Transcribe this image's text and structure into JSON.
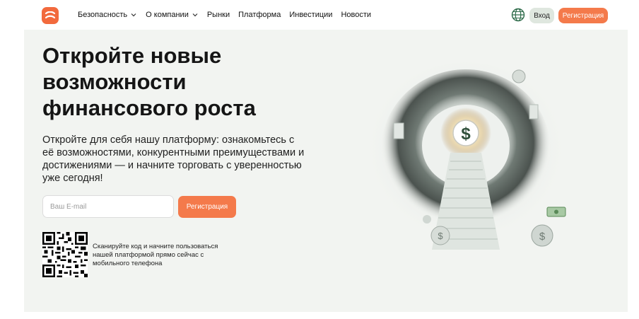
{
  "nav": {
    "items": [
      {
        "label": "Безопасность",
        "dropdown": true
      },
      {
        "label": "О компании",
        "dropdown": true
      },
      {
        "label": "Рынки",
        "dropdown": false
      },
      {
        "label": "Платформа",
        "dropdown": false
      },
      {
        "label": "Инвестиции",
        "dropdown": false
      },
      {
        "label": "Новости",
        "dropdown": false
      }
    ],
    "login_label": "Вход",
    "register_label": "Регистрация"
  },
  "hero": {
    "title": "Откройте новые возможности финансового роста",
    "subtitle": "Откройте для себя нашу платформу: ознакомьтесь с её возможностями, конкурентными преимуществами и достижениями — и начните торговать с уверенностью уже сегодня!",
    "email_placeholder": "Ваш E-mail",
    "email_value": "",
    "register_label": "Регистрация",
    "qr_text": "Сканируйте код и начните пользоваться нашей платформой прямо сейчас с мобильного телефона"
  },
  "colors": {
    "accent": "#f47a4b",
    "logo": "#f26a3d",
    "login_bg": "#dfe7df",
    "page_bg": "#f2f4f1"
  },
  "icons": {
    "logo": "brand-logo-icon",
    "globe": "globe-icon",
    "chevron": "chevron-down-icon",
    "qr": "qr-code-icon"
  }
}
